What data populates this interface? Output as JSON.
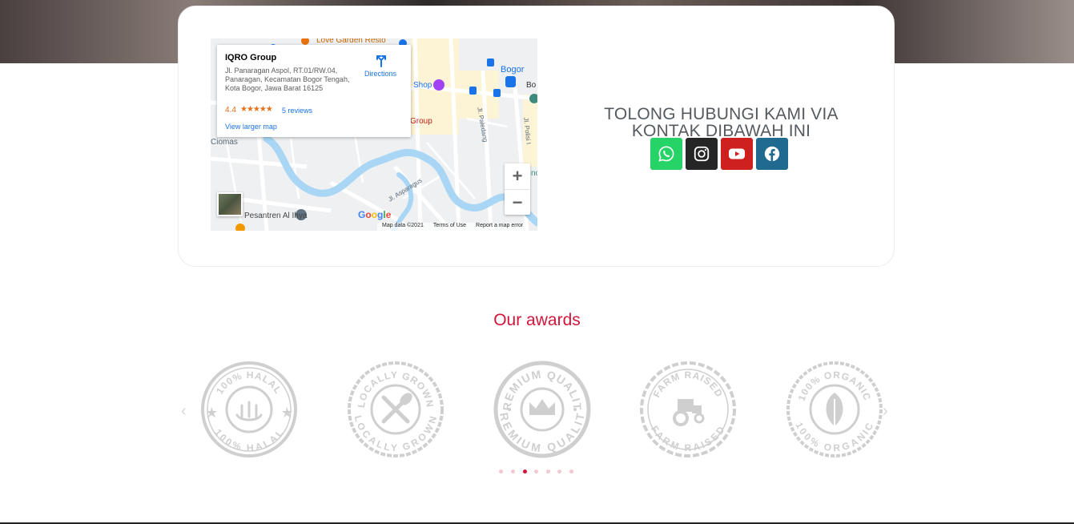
{
  "map": {
    "place_name": "IQRO Group",
    "address": "Jl. Panaragan Aspol, RT.01/RW.04, Panaragan, Kecamatan Bogor Tengah, Kota Bogor, Jawa Barat 16125",
    "rating": "4.4",
    "stars": "★★★★★",
    "rating_value": 4.4,
    "reviews_link": "5 reviews",
    "larger_map_link": "View larger map",
    "directions_label": "Directions",
    "zoom_in": "+",
    "zoom_out": "−",
    "google_logo": "Google",
    "footer": {
      "map_data": "Map data ©2021",
      "terms": "Terms of Use",
      "report": "Report a map error"
    },
    "places": {
      "love_garden": "Love Garden Resto",
      "shop": "Shop",
      "bogor": "Bogor",
      "bo": "Bo",
      "group": "Group",
      "ciomas": "Ciomas",
      "pesantren": "Pesantren Al Ihya",
      "jl_paledang": "Jl. Paledang",
      "jl_asparagus": "Jl. Asparagus",
      "jl_polisi": "Jl. Polisi I",
      "no": "no"
    }
  },
  "contact": {
    "heading_line1": "TOLONG HUBUNGI KAMI VIA",
    "heading_line2": "KONTAK DIBAWAH INI",
    "socials": [
      {
        "name": "whatsapp",
        "icon": "whatsapp-icon",
        "color": "#25d366"
      },
      {
        "name": "instagram",
        "icon": "instagram-icon",
        "color": "#262626"
      },
      {
        "name": "youtube",
        "icon": "youtube-icon",
        "color": "#cd201f"
      },
      {
        "name": "facebook",
        "icon": "facebook-icon",
        "color": "#1f6a8e"
      }
    ]
  },
  "awards": {
    "title": "Our awards",
    "title_color": "#d1163a",
    "badges": [
      {
        "name": "100% HALAL",
        "icon": "halal-badge-icon"
      },
      {
        "name": "LOCALLY GROWN",
        "icon": "locally-grown-badge-icon"
      },
      {
        "name": "PREMIUM QUALITY",
        "icon": "premium-quality-badge-icon"
      },
      {
        "name": "FARM RAISED",
        "icon": "farm-raised-badge-icon"
      },
      {
        "name": "100% ORGANIC",
        "icon": "organic-badge-icon"
      }
    ],
    "prev_arrow": "‹",
    "next_arrow": "›",
    "dot_count": 7,
    "active_dot": 3
  }
}
